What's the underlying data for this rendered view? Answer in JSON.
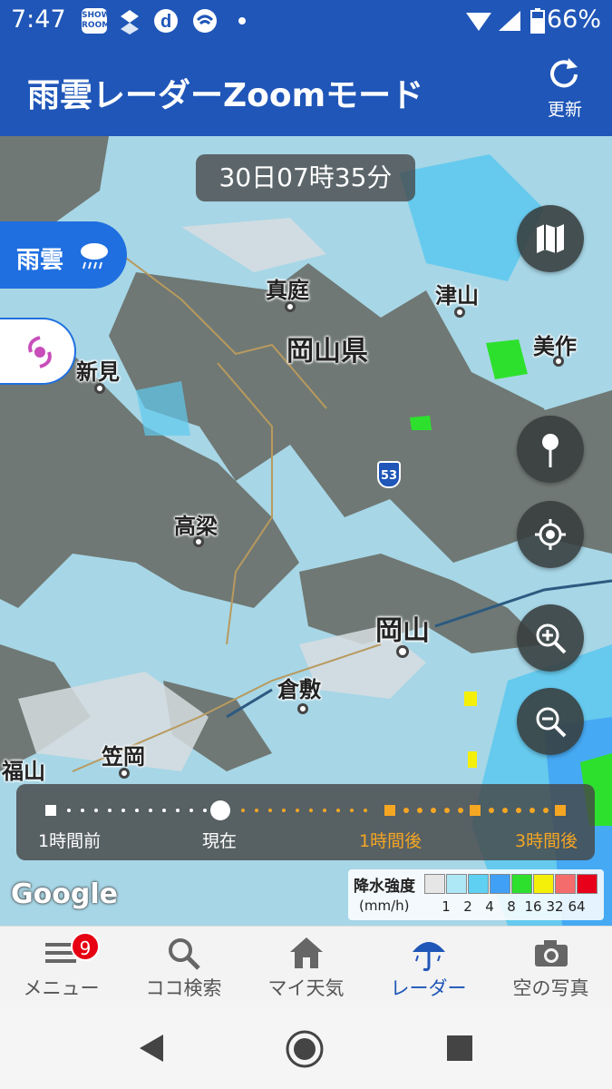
{
  "status_bar": {
    "time": "7:47",
    "icons": [
      "showroom-icon",
      "dropbox-icon",
      "d-icon",
      "wifi-icon",
      "notification-dot-icon",
      "signal-icon",
      "battery-icon"
    ],
    "showroom_text": "SHOW ROOM",
    "battery_percent": "66%"
  },
  "header": {
    "title": "雨雲レーダーZoomモード",
    "refresh_label": "更新"
  },
  "map": {
    "timestamp": "30日07時35分",
    "layer_button": "雨雲",
    "cities": [
      "真庭",
      "津山",
      "岡山県",
      "美作",
      "新見",
      "高梁",
      "岡山",
      "倉敷",
      "笠岡",
      "福山"
    ],
    "route_number": "53",
    "attribution": "Google"
  },
  "timeline": {
    "labels": [
      "1時間前",
      "現在",
      "1時間後",
      "3時間後"
    ],
    "past_color": "#ffffff",
    "future_color": "#f5a623"
  },
  "legend": {
    "title": "降水強度",
    "unit": "(mm/h)",
    "ticks": [
      "1",
      "2",
      "4",
      "8",
      "16",
      "32",
      "64"
    ],
    "colors": [
      "#e6e6e6",
      "#aee8f6",
      "#5fd0f2",
      "#3fa0f5",
      "#2ee02e",
      "#f5f00a",
      "#f56c6c",
      "#e8001a"
    ]
  },
  "bottom_nav": {
    "items": [
      "メニュー",
      "ココ検索",
      "マイ天気",
      "レーダー",
      "空の写真"
    ],
    "menu_badge": "9",
    "active_color": "#1f56b8"
  },
  "colors": {
    "brand_blue": "#1f56b8",
    "rain_pill": "#1f6fe0"
  }
}
